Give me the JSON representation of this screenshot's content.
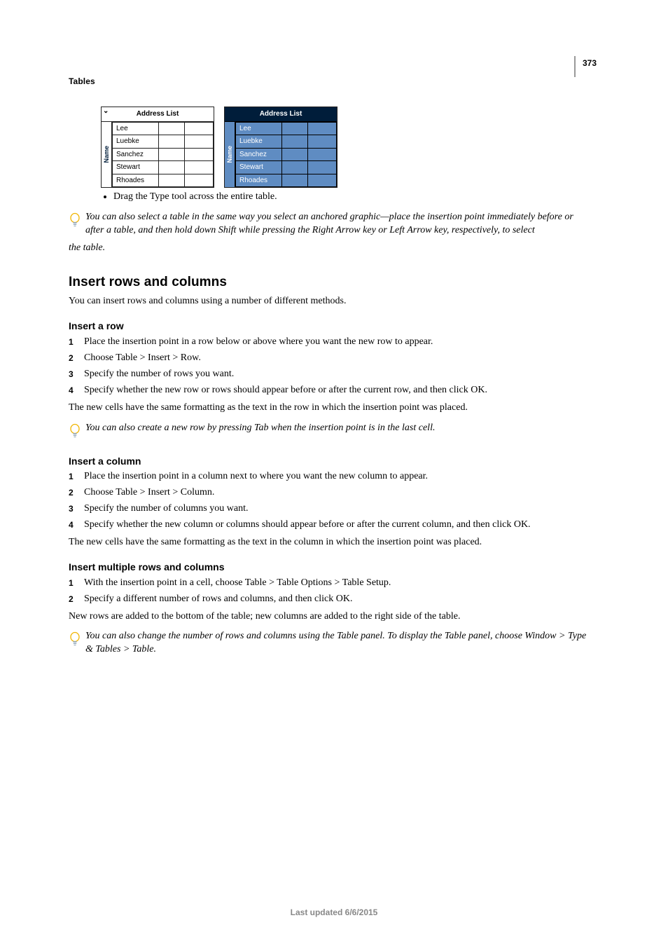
{
  "header": {
    "running_title": "Tables",
    "page_number": "373"
  },
  "figure": {
    "title": "Address List",
    "side_label": "Name",
    "rows": [
      "Lee",
      "Luebke",
      "Sanchez",
      "Stewart",
      "Rhoades"
    ]
  },
  "bullet_after_figure": "Drag the Type tool across the entire table.",
  "tip1_line1": "You can also select a table in the same way you select an anchored graphic—place the insertion point immediately before",
  "tip1_line2": "or after a table, and then hold down Shift while pressing the Right Arrow key or Left Arrow key, respectively, to select",
  "tip1_line3": "the table.",
  "section1": {
    "heading": "Insert rows and columns",
    "intro": "You can insert rows and columns using a number of different methods."
  },
  "insert_row": {
    "heading": "Insert a row",
    "steps": [
      "Place the insertion point in a row below or above where you want the new row to appear.",
      "Choose Table > Insert > Row.",
      "Specify the number of rows you want.",
      "Specify whether the new row or rows should appear before or after the current row, and then click OK."
    ],
    "after": "The new cells have the same formatting as the text in the row in which the insertion point was placed.",
    "tip": "You can also create a new row by pressing Tab when the insertion point is in the last cell."
  },
  "insert_col": {
    "heading": "Insert a column",
    "steps": [
      "Place the insertion point in a column next to where you want the new column to appear.",
      "Choose Table > Insert > Column.",
      "Specify the number of columns you want.",
      "Specify whether the new column or columns should appear before or after the current column, and then click OK."
    ],
    "after": "The new cells have the same formatting as the text in the column in which the insertion point was placed."
  },
  "insert_multi": {
    "heading": "Insert multiple rows and columns",
    "steps": [
      "With the insertion point in a cell, choose Table > Table Options > Table Setup.",
      "Specify a different number of rows and columns, and then click OK."
    ],
    "after": "New rows are added to the bottom of the table; new columns are added to the right side of the table.",
    "tip_line1": "You can also change the number of rows and columns using the Table panel. To display the Table panel, choose Window",
    "tip_line2": "> Type & Tables > Table."
  },
  "numerals": {
    "n1": "1",
    "n2": "2",
    "n3": "3",
    "n4": "4"
  },
  "footer": "Last updated 6/6/2015"
}
